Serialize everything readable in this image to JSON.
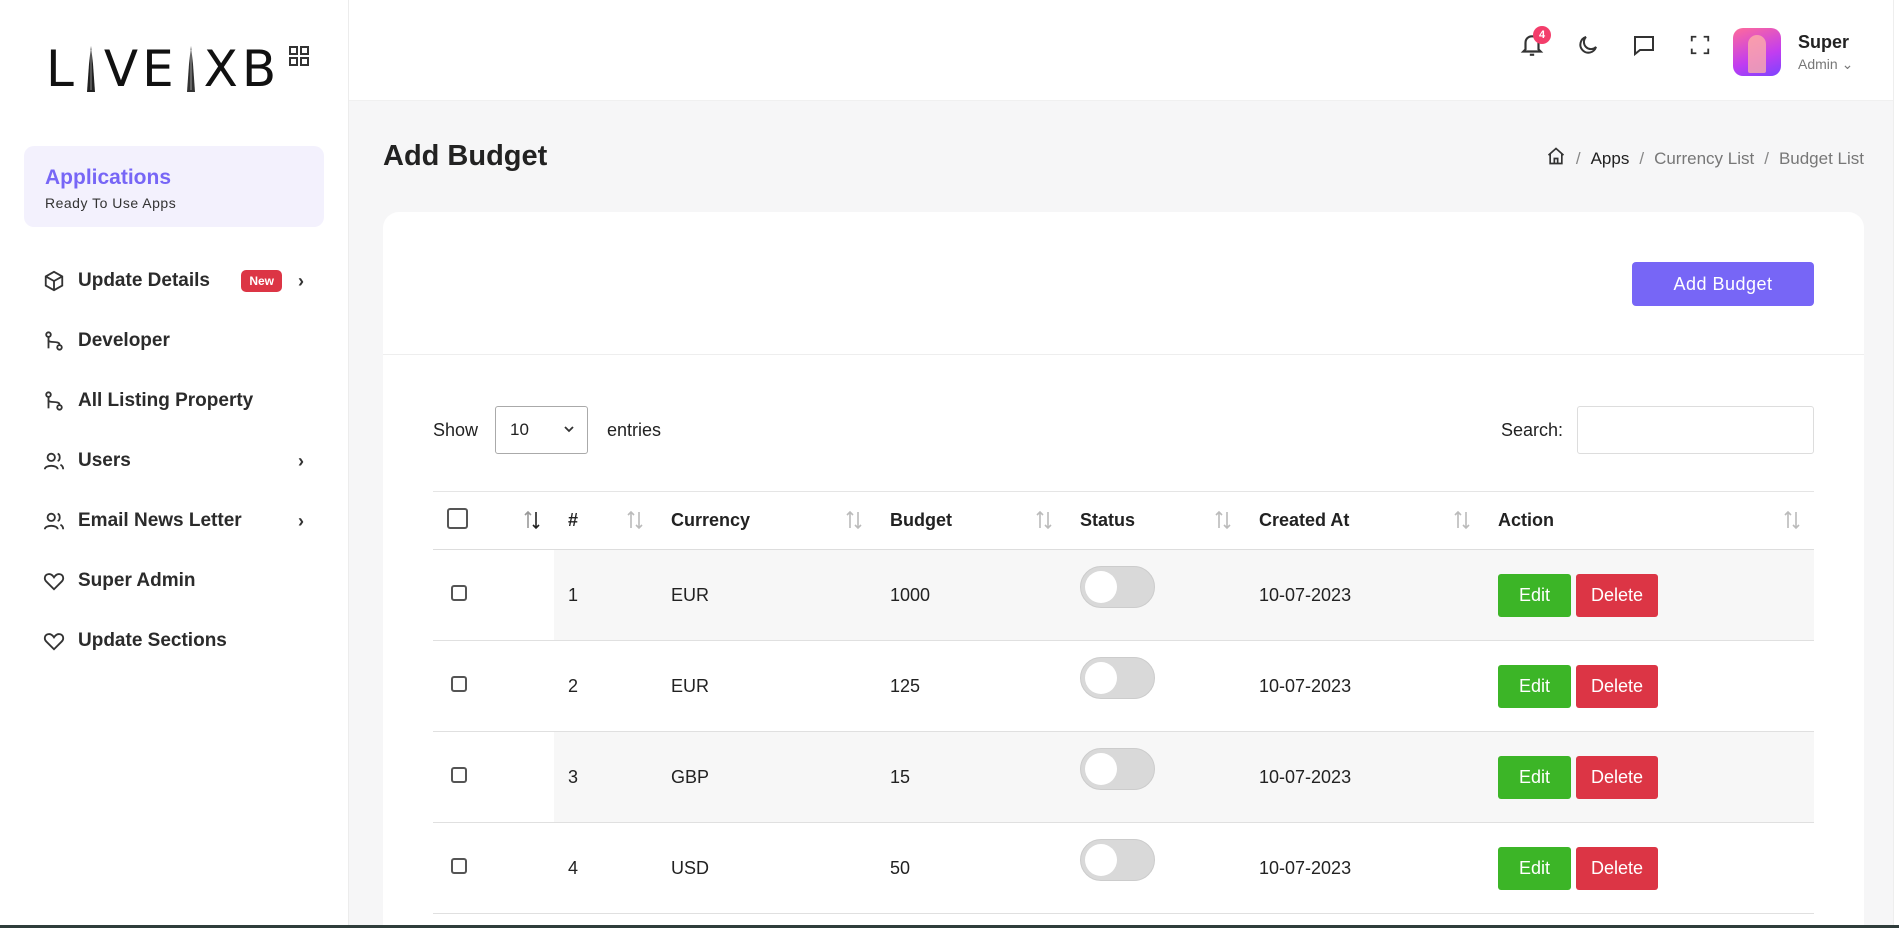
{
  "brand": {
    "logo_text_left": "L",
    "logo_text_mid": "VE",
    "logo_text_right": "XB"
  },
  "apps_card": {
    "title": "Applications",
    "subtitle": "Ready To Use Apps"
  },
  "sidebar": {
    "items": [
      {
        "label": "Update Details",
        "icon": "cube-icon",
        "badge": "New",
        "has_chevron": true
      },
      {
        "label": "Developer",
        "icon": "git-branch-icon",
        "has_chevron": false
      },
      {
        "label": "All Listing Property",
        "icon": "git-branch-icon",
        "has_chevron": false
      },
      {
        "label": "Users",
        "icon": "users-icon",
        "has_chevron": true
      },
      {
        "label": "Email News Letter",
        "icon": "users-icon",
        "has_chevron": true
      },
      {
        "label": "Super Admin",
        "icon": "heart-icon",
        "has_chevron": false
      },
      {
        "label": "Update Sections",
        "icon": "heart-icon",
        "has_chevron": false
      }
    ]
  },
  "header": {
    "notification_count": "4",
    "user": {
      "name": "Super",
      "role": "Admin"
    }
  },
  "page": {
    "title": "Add Budget",
    "breadcrumb": [
      "Apps",
      "Currency List",
      "Budget List"
    ],
    "add_button": "Add Budget"
  },
  "table_controls": {
    "show_label": "Show",
    "entries_value": "10",
    "entries_label": "entries",
    "search_label": "Search:"
  },
  "table": {
    "columns": [
      "#",
      "Currency",
      "Budget",
      "Status",
      "Created At",
      "Action"
    ],
    "rows": [
      {
        "num": "1",
        "currency": "EUR",
        "budget": "1000",
        "status": false,
        "created": "10-07-2023"
      },
      {
        "num": "2",
        "currency": "EUR",
        "budget": "125",
        "status": false,
        "created": "10-07-2023"
      },
      {
        "num": "3",
        "currency": "GBP",
        "budget": "15",
        "status": false,
        "created": "10-07-2023"
      },
      {
        "num": "4",
        "currency": "USD",
        "budget": "50",
        "status": false,
        "created": "10-07-2023"
      }
    ],
    "edit_label": "Edit",
    "delete_label": "Delete"
  },
  "colors": {
    "accent": "#7766f6",
    "edit": "#3cb527",
    "delete": "#dc3545",
    "badge": "#dc3545"
  }
}
